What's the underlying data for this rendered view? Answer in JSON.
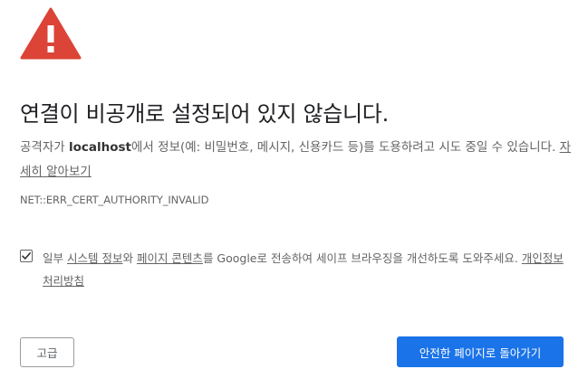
{
  "warning_icon": {
    "name": "warning-triangle-icon",
    "color": "#db4437"
  },
  "heading": "연결이 비공개로 설정되어 있지 않습니다.",
  "explanation": {
    "before_host": "공격자가 ",
    "host": "localhost",
    "after_host": "에서 정보(예: 비밀번호, 메시지, 신용카드 등)를 도용하려고 시도 중일 수 있습니다. ",
    "learn_more_link": "자세히 알아보기"
  },
  "error_code": "NET::ERR_CERT_AUTHORITY_INVALID",
  "optin": {
    "checked": true,
    "text_before": "일부 ",
    "system_info_link": "시스템 정보",
    "text_and": "와 ",
    "page_content_link": "페이지 콘텐츠",
    "text_after": "를 Google로 전송하여 세이프 브라우징을 개선하도록 도와주세요. ",
    "privacy_policy_link": "개인정보처리방침"
  },
  "buttons": {
    "advanced_label": "고급",
    "back_to_safety_label": "안전한 페이지로 돌아가기",
    "primary_color": "#1a73e8"
  }
}
